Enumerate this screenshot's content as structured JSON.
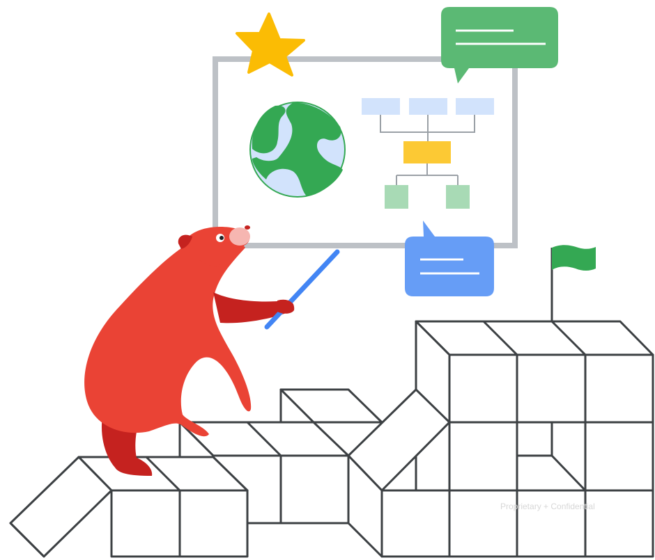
{
  "illustration": {
    "subject": "bear-presenting-at-whiteboard",
    "palette": {
      "bear": "#ea4335",
      "bear_shadow": "#c5221f",
      "snout": "#f6b6b1",
      "pointer": "#4285f4",
      "board_frame": "#bdc1c6",
      "star": "#fbbc04",
      "green": "#34a853",
      "green_bubble": "#5bb974",
      "blue_bubble": "#669df6",
      "globe_water": "#d2e3fc",
      "chart_top_boxes": "#d2e3fc",
      "chart_mid_box": "#fcc934",
      "chart_leaf_boxes": "#a8dab5",
      "blocks_outline": "#3c4043"
    },
    "icons": [
      "star-icon",
      "globe-icon",
      "org-chart-icon",
      "speech-bubble-icon",
      "flag-icon"
    ]
  },
  "watermark": "Proprietary + Confidential"
}
